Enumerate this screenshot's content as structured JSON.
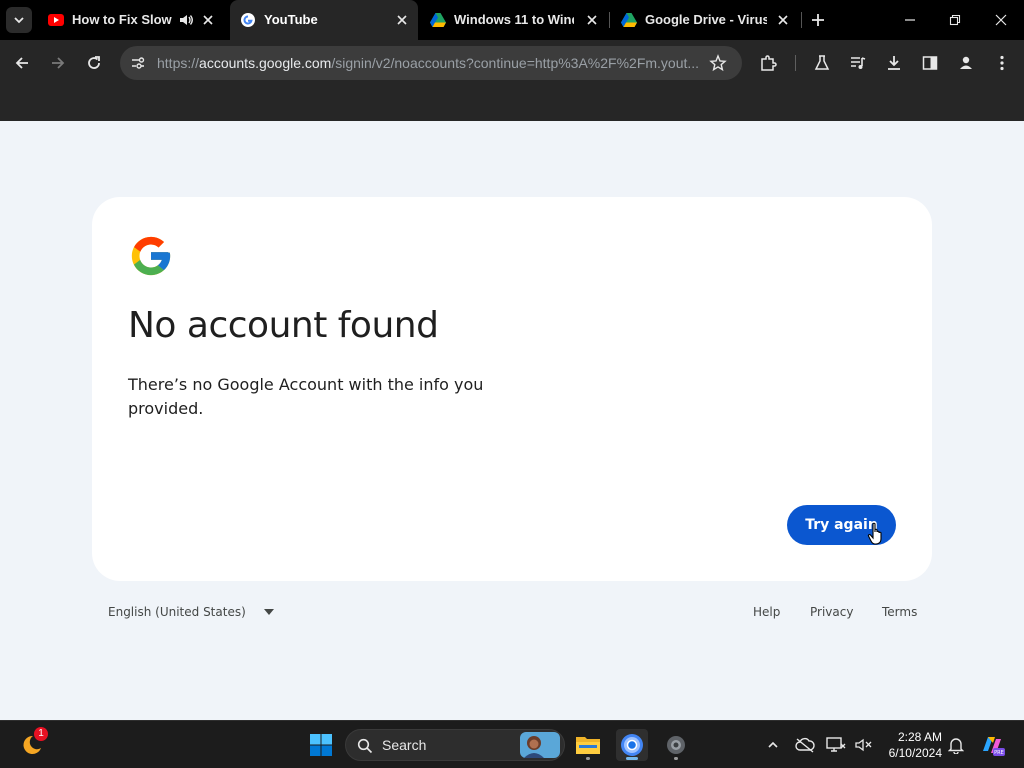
{
  "tabs": [
    {
      "title": "How to Fix Slow P",
      "favicon": "youtube-icon"
    },
    {
      "title": "YouTube",
      "favicon": "google-g-icon"
    },
    {
      "title": "Windows 11 to Windo",
      "favicon": "google-drive-icon"
    },
    {
      "title": "Google Drive - Virus s",
      "favicon": "google-drive-icon"
    }
  ],
  "address": {
    "scheme": "https://",
    "host": "accounts.google.com",
    "path": "/signin/v2/noaccounts?continue=http%3A%2F%2Fm.yout..."
  },
  "page": {
    "heading": "No account found",
    "message": "There’s no Google Account with the info you provided.",
    "try_again_label": "Try again",
    "language": "English (United States)",
    "footer_links": [
      "Help",
      "Privacy",
      "Terms"
    ]
  },
  "taskbar": {
    "search_label": "Search",
    "time": "2:28 AM",
    "date": "6/10/2024",
    "weather_badge": "1"
  },
  "colors": {
    "primary_button": "#0b57d0",
    "page_bg": "#f0f4f9"
  }
}
